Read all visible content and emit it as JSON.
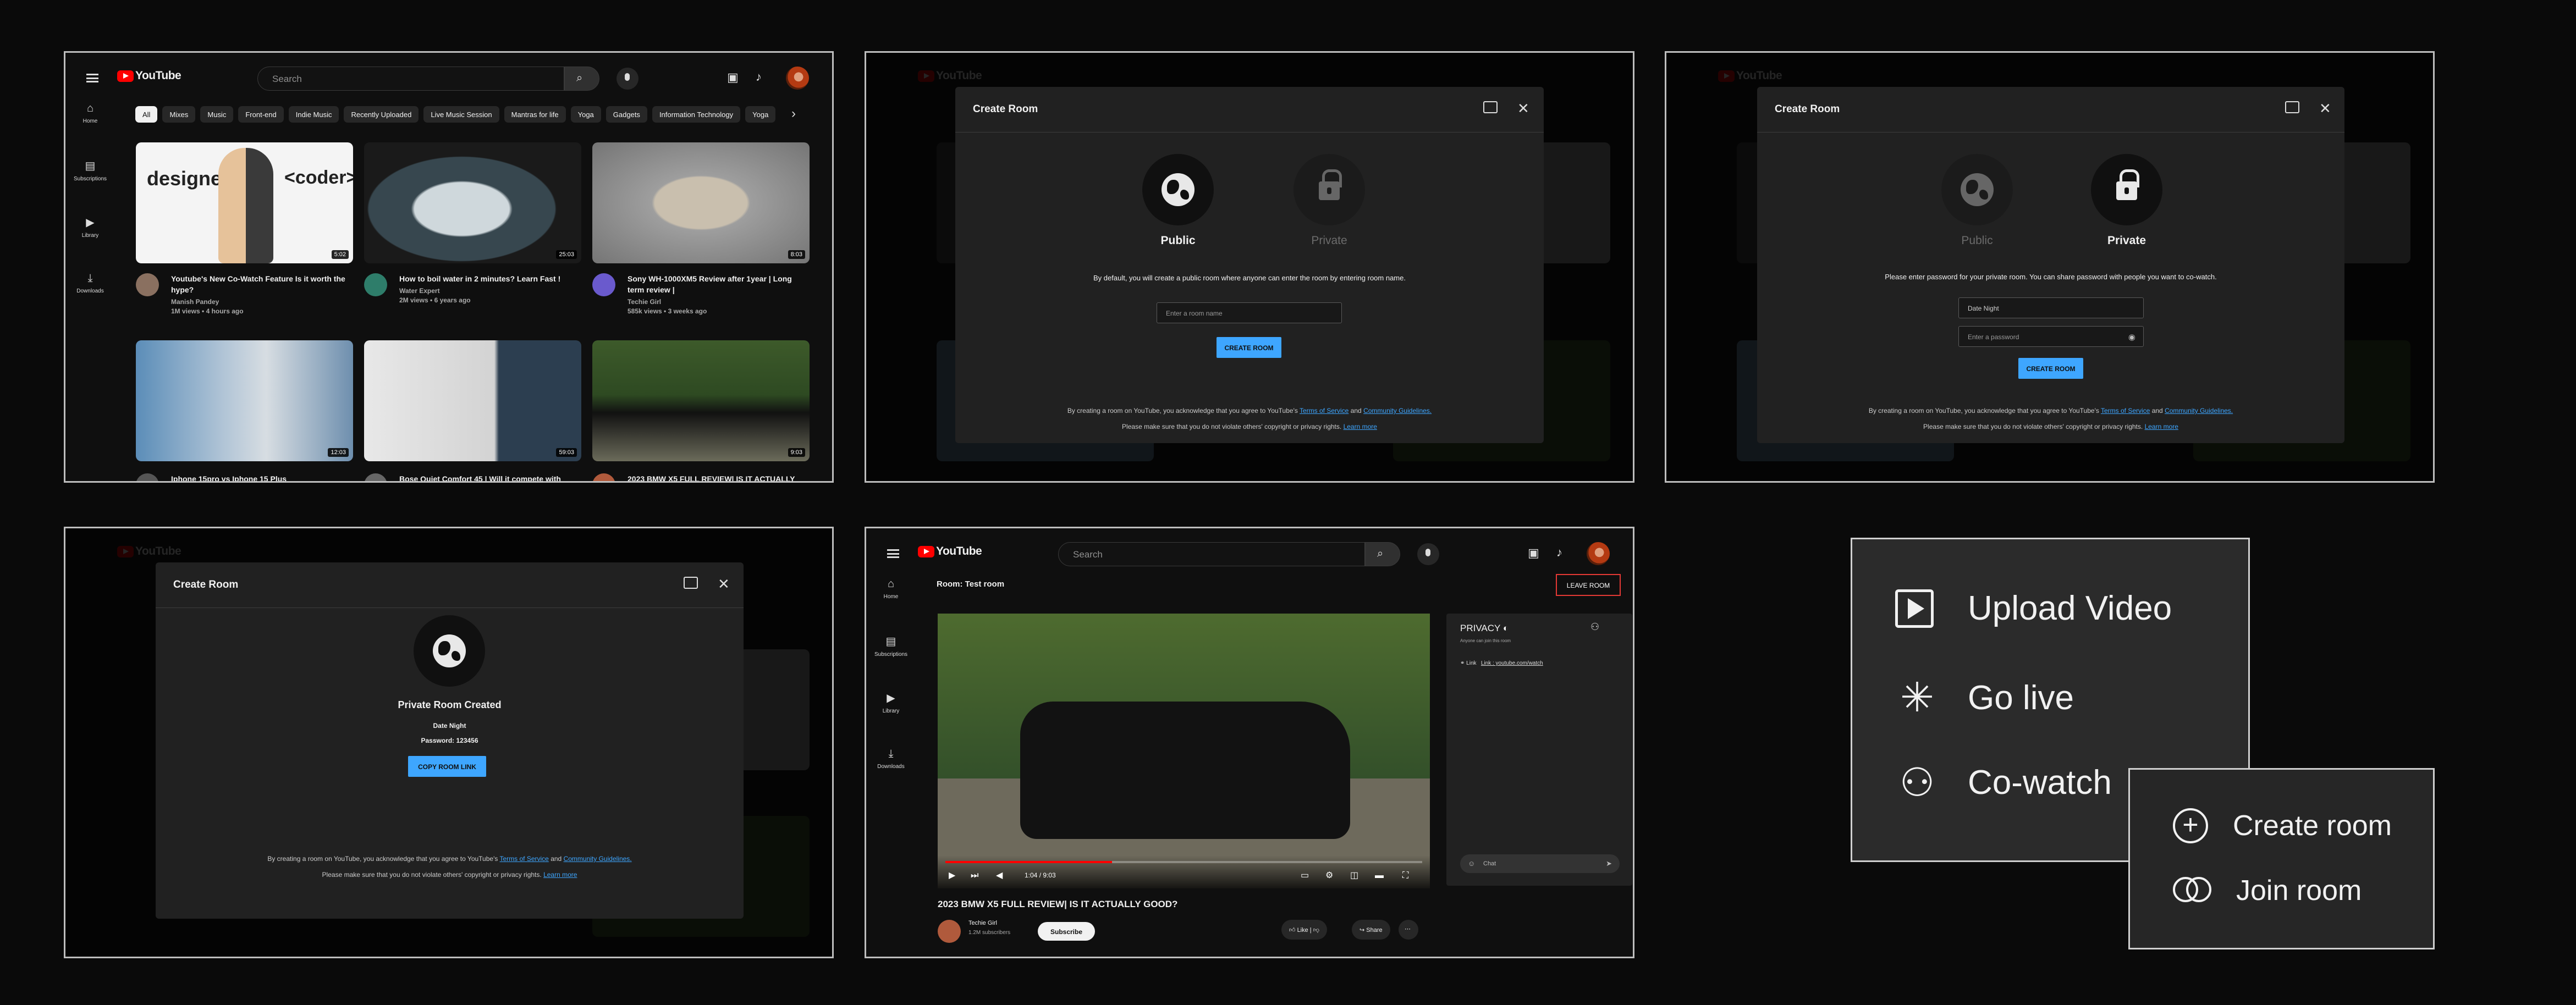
{
  "youtube": {
    "logo": "YouTube",
    "search_placeholder": "Search",
    "rail": {
      "home": "Home",
      "subscriptions": "Subscriptions",
      "library": "Library",
      "downloads": "Downloads"
    },
    "chips": [
      "All",
      "Mixes",
      "Music",
      "Front-end",
      "Indie Music",
      "Recently Uploaded",
      "Live Music Session",
      "Mantras for life",
      "Yoga",
      "Gadgets",
      "Information Technology",
      "Yoga"
    ],
    "videos": [
      {
        "title": "Youtube's New Co-Watch Feature Is it worth the hype?",
        "channel": "Manish Pandey",
        "stats": "1M views • 4 hours ago",
        "duration": "5:02"
      },
      {
        "title": "How to boil water in 2 minutes? Learn Fast !",
        "channel": "Water Expert",
        "stats": "2M views • 6 years ago",
        "duration": "25:03"
      },
      {
        "title": "Sony WH-1000XM5 Review after 1year | Long term review |",
        "channel": "Techie Girl",
        "stats": "585k views • 3 weeks ago",
        "duration": "8:03"
      },
      {
        "title": "Iphone 15pro vs Iphone 15 Plus",
        "channel": "",
        "stats": "",
        "duration": "12:03"
      },
      {
        "title": "Bose Quiet Comfort 45 | Will it compete with",
        "channel": "",
        "stats": "",
        "duration": "59:03"
      },
      {
        "title": "2023 BMW X5 FULL REVIEW| IS IT ACTUALLY",
        "channel": "",
        "stats": "",
        "duration": "9:03"
      }
    ]
  },
  "create_room": {
    "title": "Create Room",
    "public_label": "Public",
    "private_label": "Private",
    "public_desc": "By default, you will create a public room where anyone can enter the room by  entering room name.",
    "private_desc": "Please enter password for your private room. You can share password with people you want to co-watch.",
    "room_name_placeholder": "Enter a room name",
    "room_name_value": "Date Night",
    "password_placeholder": "Enter a password",
    "create_button": "CREATE ROOM",
    "legal_prefix": "By creating a room on YouTube, you acknowledge that you agree to YouTube's",
    "terms": "Terms of Service",
    "and": "and",
    "guidelines": "Community Guidelines.",
    "legal_line2": "Please make sure that you do not violate others' copyright or privacy rights.",
    "learn_more": "Learn more"
  },
  "room_created": {
    "title": "Private Room Created",
    "room_name": "Date Night",
    "password": "Password: 123456",
    "copy_button": "COPY ROOM LINK"
  },
  "room_view": {
    "room_label": "Room: Test room",
    "leave_button": "LEAVE ROOM",
    "video_title": "2023 BMW X5 FULL REVIEW| IS IT ACTUALLY GOOD?",
    "channel": "Techie Girl",
    "subscribers": "1.2M subscribers",
    "subscribe": "Subscribe",
    "time": "1:04 / 9:03",
    "progress": 0.35,
    "like": "Like",
    "share": "Share",
    "privacy_title": "PRIVACY",
    "privacy_sub": "Anyone can join this room",
    "link_label": "Link",
    "link_value": "Link : youtube.com/watch",
    "chat_placeholder": "Chat"
  },
  "create_menu": {
    "upload": "Upload Video",
    "live": "Go live",
    "cowatch": "Co-watch",
    "create_room": "Create room",
    "join_room": "Join room"
  },
  "colors": {
    "brand_red": "#ff0000",
    "accent_blue": "#3ea6ff",
    "bg": "#0f0f0f",
    "modal": "#212121"
  }
}
